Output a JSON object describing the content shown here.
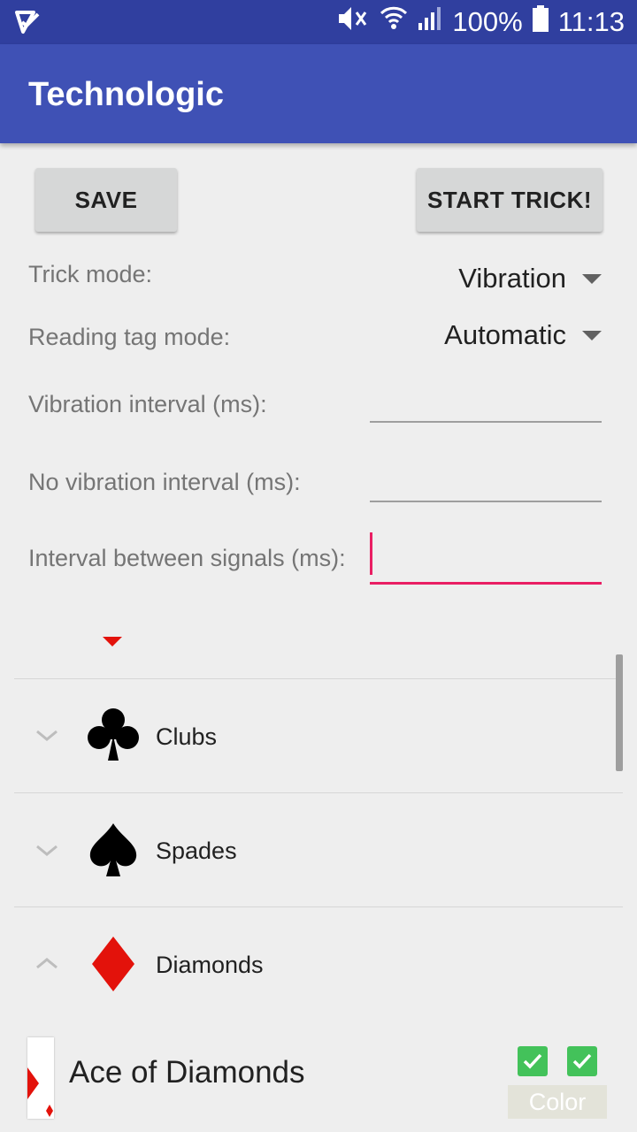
{
  "status_bar": {
    "battery": "100%",
    "time": "11:13",
    "icons": [
      "app-notification-icon",
      "mute-icon",
      "wifi-icon",
      "signal-icon",
      "battery-icon"
    ]
  },
  "app_bar": {
    "title": "Technologic"
  },
  "buttons": {
    "save": "SAVE",
    "start": "START TRICK!"
  },
  "settings": {
    "trick_mode_label": "Trick mode:",
    "trick_mode_value": "Vibration",
    "reading_tag_label": "Reading tag mode:",
    "reading_tag_value": "Automatic",
    "vibration_interval_label": "Vibration interval (ms):",
    "vibration_interval_value": "",
    "no_vibration_interval_label": "No vibration interval (ms):",
    "no_vibration_interval_value": "",
    "between_signals_label": "Interval between signals (ms):",
    "between_signals_value": ""
  },
  "groups": [
    {
      "label": "Clubs",
      "icon": "clubs-icon",
      "expanded": false,
      "color": "#000000"
    },
    {
      "label": "Spades",
      "icon": "spades-icon",
      "expanded": false,
      "color": "#000000"
    },
    {
      "label": "Diamonds",
      "icon": "diamonds-icon",
      "expanded": true,
      "color": "#e3120b"
    }
  ],
  "card": {
    "name": "Ace of Diamonds",
    "color_label": "Color"
  },
  "colors": {
    "primary": "#3f51b5",
    "primary_dark": "#303f9f",
    "accent": "#e91e63",
    "check_green": "#43c25a"
  }
}
